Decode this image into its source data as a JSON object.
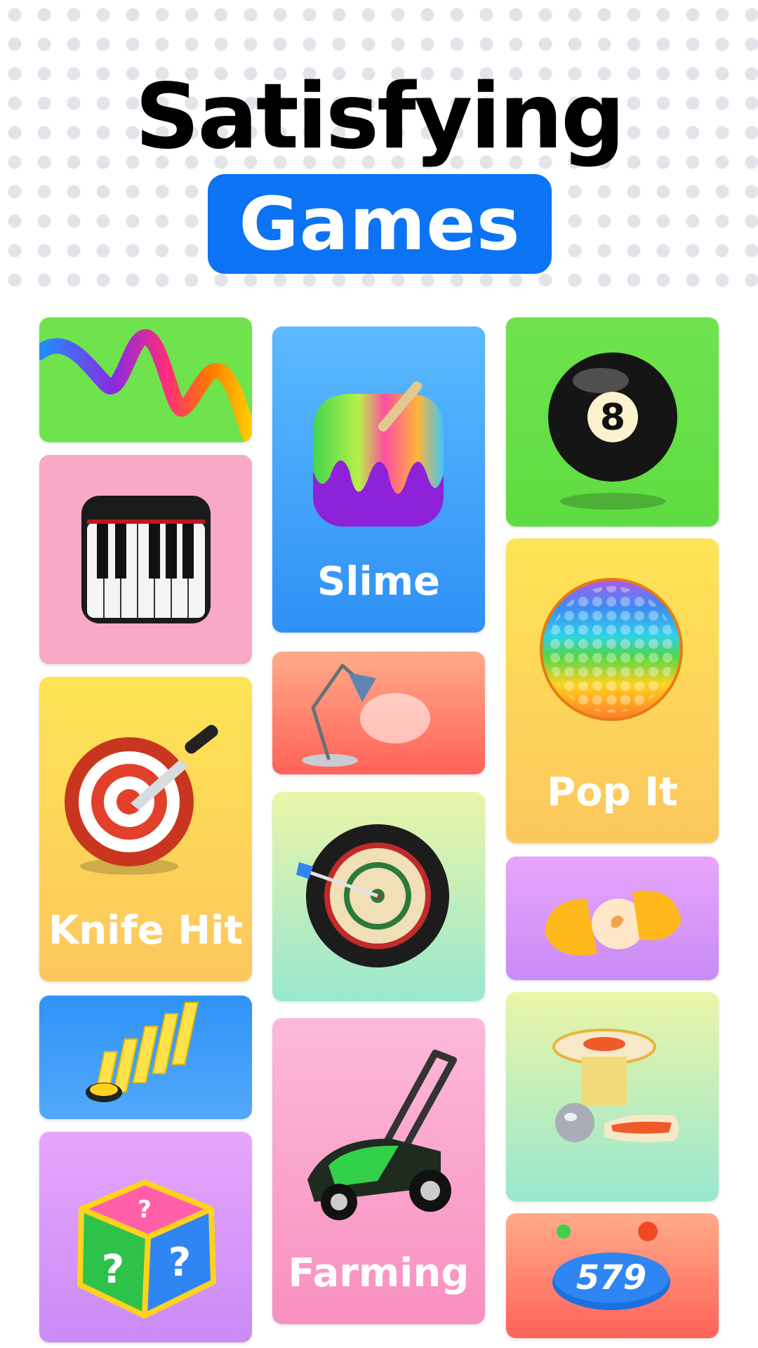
{
  "headline": {
    "title": "Satisfying",
    "badge": "Games"
  },
  "tiles": {
    "ribbon": {
      "icon": "ribbon-icon"
    },
    "piano": {
      "icon": "piano-icon"
    },
    "knife_hit": {
      "label": "Knife Hit",
      "icon": "knife-target-icon"
    },
    "domino": {
      "icon": "domino-icon"
    },
    "mystery_box": {
      "icon": "mystery-box-icon",
      "marks": [
        "?",
        "?",
        "?"
      ]
    },
    "slime": {
      "label": "Slime",
      "icon": "slime-icon"
    },
    "lamp": {
      "icon": "desk-lamp-icon"
    },
    "darts": {
      "icon": "dartboard-icon"
    },
    "farming": {
      "label": "Farming",
      "icon": "lawn-mower-icon"
    },
    "pool": {
      "icon": "eight-ball-icon",
      "number": "8"
    },
    "pop_it": {
      "label": "Pop It",
      "icon": "pop-it-icon"
    },
    "egg": {
      "icon": "surprise-egg-icon"
    },
    "pinball": {
      "icon": "pinball-icon"
    },
    "counter": {
      "icon": "counter-button-icon",
      "number": "579"
    }
  },
  "colors": {
    "brand_blue": "#0b73f4",
    "headline": "#000000"
  }
}
